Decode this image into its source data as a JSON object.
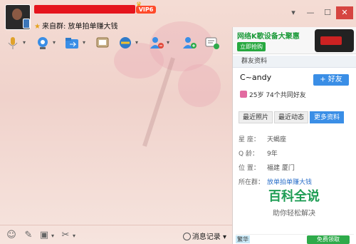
{
  "header": {
    "vip_badge": "VIP6",
    "from_label": "来自群:",
    "group_name": "放单拍单赚大钱"
  },
  "window_controls": [
    "▾",
    "—",
    "☐",
    "✕"
  ],
  "toolbar": {
    "icons": [
      "microphone-icon",
      "video-icon",
      "file-transfer-icon",
      "screen-share-icon",
      "remote-assist-icon",
      "remove-user-icon",
      "add-user-icon",
      "message-history-icon"
    ]
  },
  "bottom_bar": {
    "icons": [
      "emoji-icon",
      "font-icon",
      "image-icon",
      "scissors-icon"
    ],
    "history_label": "消息记录"
  },
  "ad": {
    "title": "网络K歌设备大聚惠",
    "button": "立即抢购"
  },
  "profile": {
    "section_title": "群友资料",
    "nickname": "C~andy",
    "add_friend": "+ 好友",
    "age_info": "25岁  74个共同好友",
    "tabs": [
      {
        "label": "最近照片",
        "active": false
      },
      {
        "label": "最近动态",
        "active": false
      },
      {
        "label": "更多资料",
        "active": true
      }
    ],
    "rows": [
      {
        "k": "星  座：",
        "v": "天蝎座"
      },
      {
        "k": "Q  龄：",
        "v": "9年"
      },
      {
        "k": "位  置：",
        "v": "福建 厦门"
      },
      {
        "k": "所在群：",
        "v": "放单拍单赚大钱"
      }
    ]
  },
  "watermark": {
    "title": "百科全说",
    "subtitle": "助你轻松解决"
  },
  "bottom_ad": {
    "label": "繁华",
    "button": "免费领取"
  },
  "colors": {
    "accent": "#3a8ee6",
    "green": "#1f9d55",
    "red": "#e5141d"
  }
}
